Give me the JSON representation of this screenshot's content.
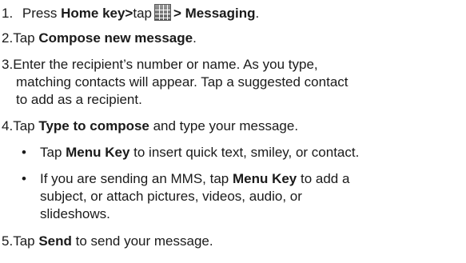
{
  "steps": {
    "s1": {
      "num": "1.",
      "t1": "Press ",
      "b1": "Home key>",
      "t2": "tap",
      "icon": "app-grid-icon",
      "b2": "> Messaging",
      "t3": "."
    },
    "s2": {
      "num": "2.",
      "t1": "Tap ",
      "b1": "Compose new message",
      "t2": "."
    },
    "s3": {
      "num": "3.",
      "l1": "Enter the recipient’s number or name. As you type,",
      "l2": "matching contacts will appear. Tap a suggested contact",
      "l3": "to add as a recipient."
    },
    "s4": {
      "num": "4.",
      "t1": "Tap ",
      "b1": "Type to compose",
      "t2": " and type your message."
    },
    "bullets": {
      "b1": {
        "t1": "Tap ",
        "b1": "Menu Key",
        "t2": " to insert quick text, smiley, or contact."
      },
      "b2": {
        "l1a": "If you are sending an MMS, tap ",
        "l1b": "Menu Key",
        "l1c": " to add a",
        "l2": "subject, or attach pictures, videos, audio, or",
        "l3": "slideshows."
      }
    },
    "s5": {
      "num": "5.",
      "t1": "Tap ",
      "b1": "Send",
      "t2": " to send your message."
    }
  }
}
